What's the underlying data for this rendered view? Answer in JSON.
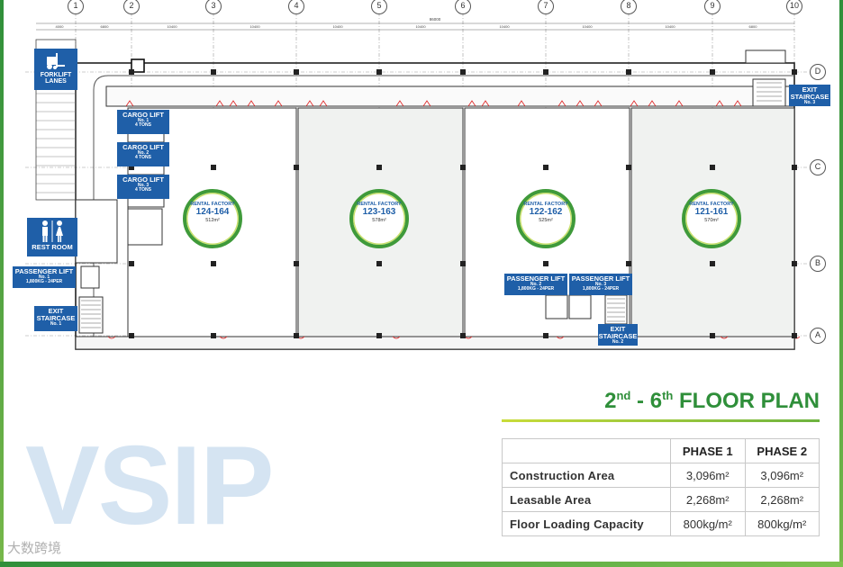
{
  "grid": {
    "columns": [
      "1",
      "2",
      "3",
      "4",
      "5",
      "6",
      "7",
      "8",
      "9",
      "10"
    ],
    "rows": [
      "D",
      "C",
      "B",
      "A"
    ]
  },
  "dims": {
    "overall": "86000",
    "bays": [
      "4000",
      "6800",
      "10400",
      "10400",
      "10400",
      "10400",
      "10400",
      "10400",
      "10400",
      "6800"
    ]
  },
  "labels": {
    "forklift": "FORKLIFT LANES",
    "cargo_lifts": [
      {
        "t": "CARGO LIFT",
        "n": "No. 1",
        "c": "4 TONS"
      },
      {
        "t": "CARGO LIFT",
        "n": "No. 2",
        "c": "4 TONS"
      },
      {
        "t": "CARGO LIFT",
        "n": "No. 3",
        "c": "4 TONS"
      }
    ],
    "rest_room": "REST ROOM",
    "passenger_lift_1": {
      "t": "PASSENGER LIFT",
      "n": "No. 1",
      "c": "1,800KG - 24PER"
    },
    "passenger_lift_2": {
      "t": "PASSENGER LIFT",
      "n": "No. 2",
      "c": "1,800KG - 24PER"
    },
    "passenger_lift_3": {
      "t": "PASSENGER LIFT",
      "n": "No. 3",
      "c": "1,800KG - 24PER"
    },
    "exit_1": {
      "t": "EXIT STAIRCASE",
      "n": "No. 1"
    },
    "exit_2": {
      "t": "EXIT STAIRCASE",
      "n": "No. 2"
    },
    "exit_3": {
      "t": "EXIT STAIRCASE",
      "n": "No. 3"
    }
  },
  "units": [
    {
      "type": "RENTAL FACTORY",
      "id": "124-164",
      "area": "512m²"
    },
    {
      "type": "RENTAL FACTORY",
      "id": "123-163",
      "area": "578m²"
    },
    {
      "type": "RENTAL FACTORY",
      "id": "122-162",
      "area": "525m²"
    },
    {
      "type": "RENTAL FACTORY",
      "id": "121-161",
      "area": "570m²"
    }
  ],
  "title": {
    "prefix1": "2",
    "sup1": "nd",
    "mid": " - 6",
    "sup2": "th",
    "suffix": " FLOOR PLAN"
  },
  "table": {
    "headers": [
      "",
      "PHASE 1",
      "PHASE 2"
    ],
    "rows": [
      [
        "Construction Area",
        "3,096m²",
        "3,096m²"
      ],
      [
        "Leasable Area",
        "2,268m²",
        "2,268m²"
      ],
      [
        "Floor Loading Capacity",
        "800kg/m²",
        "800kg/m²"
      ]
    ]
  },
  "logo": "VSIP",
  "watermark": "大数跨境",
  "colors": {
    "brand_green": "#2f8f3a",
    "brand_blue": "#1f5fa8",
    "lime": "#c9dc3a"
  }
}
